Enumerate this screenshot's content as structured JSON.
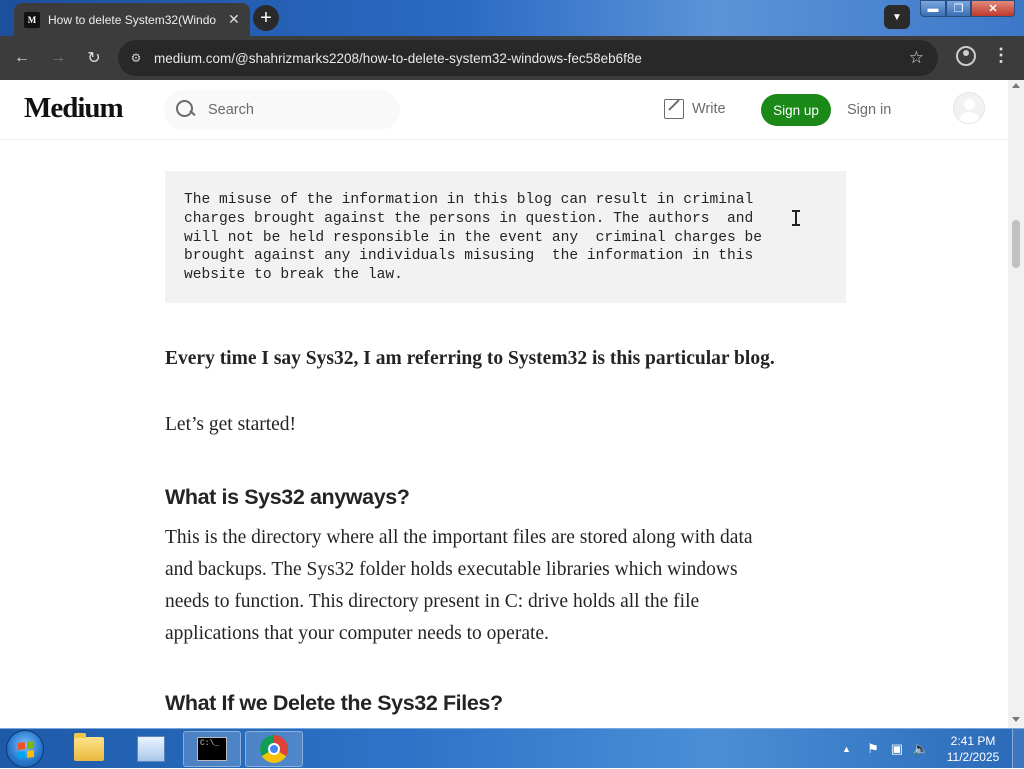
{
  "browser": {
    "tab": {
      "favicon": "M",
      "title": "How to delete System32(Windo",
      "close_icon": "close-icon"
    },
    "new_tab_icon": "plus-icon",
    "url": "medium.com/@shahrizmarks2208/how-to-delete-system32-windows-fec58eb6f8e"
  },
  "header": {
    "logo": "Medium",
    "search_placeholder": "Search",
    "write_label": "Write",
    "signup_label": "Sign up",
    "signin_label": "Sign in"
  },
  "article": {
    "code_lines": [
      "The misuse of the information in this blog can result in criminal",
      "charges brought against the persons in question. The authors  and",
      "will not be held responsible in the event any  criminal charges be",
      "brought against any individuals misusing  the information in this",
      "website to break the law."
    ],
    "bold_note": "Every time I say Sys32, I am referring to System32 is this particular blog.",
    "intro": "Let’s get started!",
    "heading1": "What is Sys32 anyways?",
    "paragraph1_lines": [
      "This is the directory where all the important files are stored along with data",
      "and backups. The Sys32 folder holds executable libraries which windows",
      "needs to function. This directory present in C: drive holds all the file",
      "applications that your computer needs to operate."
    ],
    "heading2": "What If we Delete the Sys32 Files?"
  },
  "taskbar": {
    "cmd_text": "C:\\_",
    "time": "2:41 PM",
    "date": "11/2/2025"
  },
  "colors": {
    "signup_green": "#1a8917",
    "text": "#242424",
    "muted": "#6b6b6b",
    "code_bg": "#f2f2f2",
    "browser_dark": "#3c3c3c"
  }
}
